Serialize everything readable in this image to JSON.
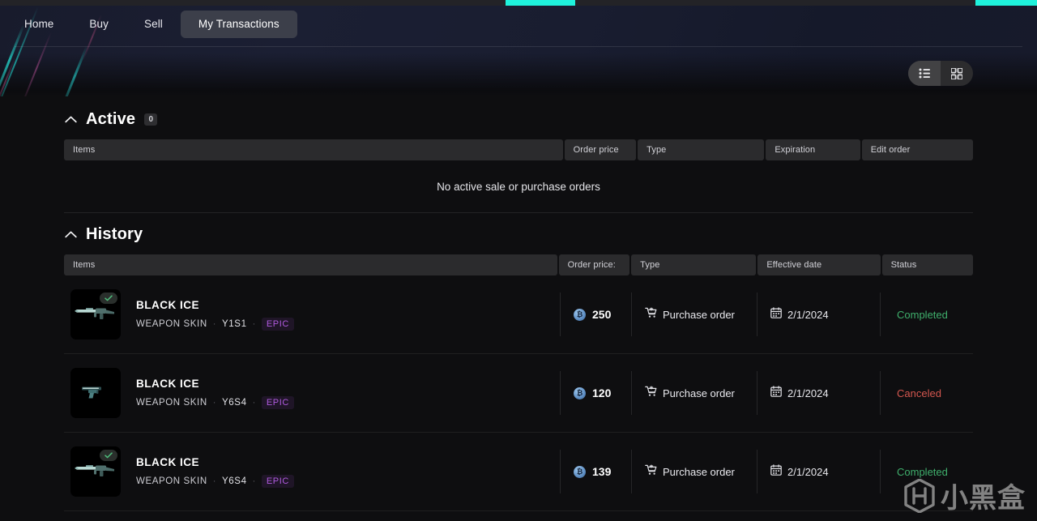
{
  "nav": {
    "items": [
      {
        "label": "Home",
        "active": false
      },
      {
        "label": "Buy",
        "active": false
      },
      {
        "label": "Sell",
        "active": false
      },
      {
        "label": "My Transactions",
        "active": true
      }
    ]
  },
  "toolbar": {
    "list_view_icon": "list-view-icon",
    "grid_view_icon": "grid-view-icon",
    "active_view": "list"
  },
  "active_section": {
    "title": "Active",
    "count": "0",
    "collapse_icon": "chevron-up-icon",
    "columns": [
      "Items",
      "Order price",
      "Type",
      "Expiration",
      "Edit order"
    ],
    "empty_message": "No active sale or purchase orders"
  },
  "history_section": {
    "title": "History",
    "collapse_icon": "chevron-up-icon",
    "columns": [
      "Items",
      "Order price:",
      "Type",
      "Effective date",
      "Status"
    ],
    "rows": [
      {
        "name": "BLACK ICE",
        "category": "WEAPON SKIN",
        "season": "Y1S1",
        "rarity": "EPIC",
        "price": "250",
        "currency_icon": "credit-coin-icon",
        "type": "Purchase order",
        "type_icon": "cart-icon",
        "date": "2/1/2024",
        "date_icon": "calendar-icon",
        "status": "Completed",
        "status_kind": "completed",
        "owned": true,
        "weapon": "rifle"
      },
      {
        "name": "BLACK ICE",
        "category": "WEAPON SKIN",
        "season": "Y6S4",
        "rarity": "EPIC",
        "price": "120",
        "currency_icon": "credit-coin-icon",
        "type": "Purchase order",
        "type_icon": "cart-icon",
        "date": "2/1/2024",
        "date_icon": "calendar-icon",
        "status": "Canceled",
        "status_kind": "canceled",
        "owned": false,
        "weapon": "pistol"
      },
      {
        "name": "BLACK ICE",
        "category": "WEAPON SKIN",
        "season": "Y6S4",
        "rarity": "EPIC",
        "price": "139",
        "currency_icon": "credit-coin-icon",
        "type": "Purchase order",
        "type_icon": "cart-icon",
        "date": "2/1/2024",
        "date_icon": "calendar-icon",
        "status": "Completed",
        "status_kind": "completed",
        "owned": true,
        "weapon": "rifle"
      }
    ]
  },
  "watermark": {
    "text": "小黑盒",
    "logo": "hei-he-logo"
  },
  "colors": {
    "accent": "#1ff2dc",
    "completed": "#3faf6c",
    "canceled": "#d4574f",
    "rarity_epic": "#b15be0"
  }
}
